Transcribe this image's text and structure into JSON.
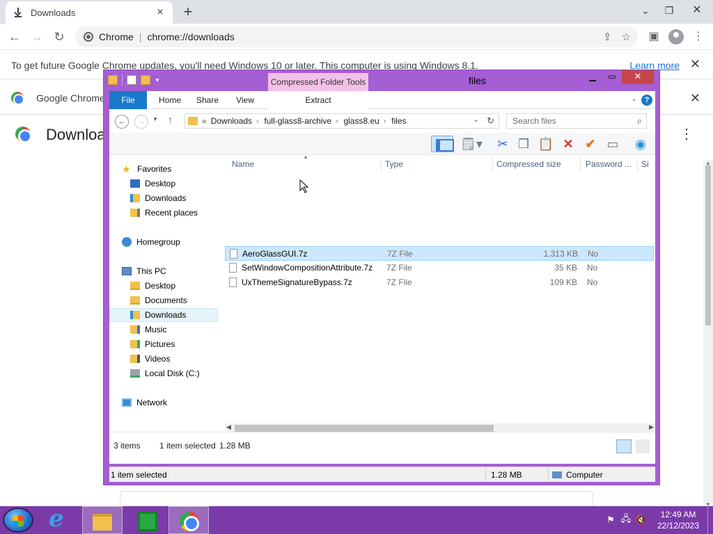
{
  "chrome": {
    "tab": {
      "title": "Downloads",
      "icon": "download-icon"
    },
    "new_tab": "+",
    "window_controls": {
      "minimize": "⌄",
      "restore": "❐",
      "close": "✕"
    },
    "omnibox": {
      "site_name": "Chrome",
      "url": "chrome://downloads"
    },
    "infobar": {
      "message": "To get future Google Chrome updates, you'll need Windows 10 or later. This computer is using Windows 8.1.",
      "link": "Learn more",
      "close": "✕"
    },
    "banner": {
      "text": "Google Chrome",
      "close": "✕"
    },
    "page_title": "Downloads",
    "menu": "⋮"
  },
  "explorer": {
    "title": "files",
    "context_tab": "Compressed Folder Tools",
    "ribbon_tabs": [
      "File",
      "Home",
      "Share",
      "View",
      "Extract"
    ],
    "address": {
      "overflow": "«",
      "crumbs": [
        "Downloads",
        "full-glass8-archive",
        "glass8.eu",
        "files"
      ]
    },
    "search_placeholder": "Search files",
    "nav": {
      "favorites": "Favorites",
      "fav_items": [
        "Desktop",
        "Downloads",
        "Recent places"
      ],
      "homegroup": "Homegroup",
      "this_pc": "This PC",
      "pc_items": [
        "Desktop",
        "Documents",
        "Downloads",
        "Music",
        "Pictures",
        "Videos",
        "Local Disk (C:)"
      ],
      "network": "Network"
    },
    "columns": [
      "Name",
      "Type",
      "Compressed size",
      "Password ...",
      "Si"
    ],
    "files": [
      {
        "name": "AeroGlassGUI.7z",
        "type": "7Z File",
        "size": "1,313 KB",
        "password": "No"
      },
      {
        "name": "SetWindowCompositionAttribute.7z",
        "type": "7Z File",
        "size": "35 KB",
        "password": "No"
      },
      {
        "name": "UxThemeSignatureBypass.7z",
        "type": "7Z File",
        "size": "109 KB",
        "password": "No"
      }
    ],
    "details": {
      "count": "3 items",
      "selected": "1 item selected",
      "size": "1.28 MB"
    },
    "status": {
      "left": "1 item selected",
      "size": "1.28 MB",
      "location": "Computer"
    }
  },
  "taskbar": {
    "clock_time": "12:49 AM",
    "clock_date": "22/12/2023"
  }
}
